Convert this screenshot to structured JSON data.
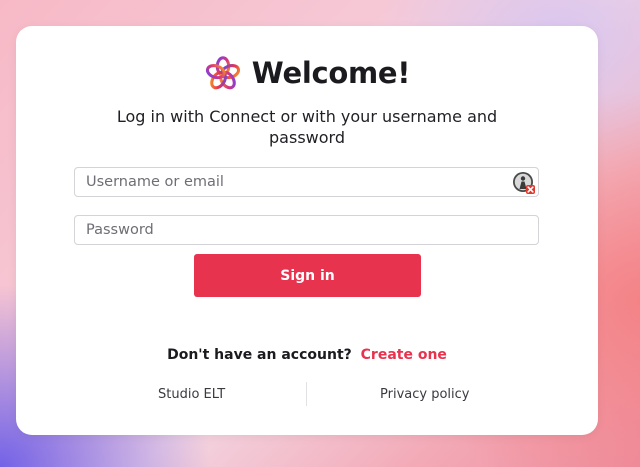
{
  "header": {
    "title": "Welcome!",
    "subtitle": "Log in with Connect or with your username and password",
    "logo_icon": "flower-ring-logo-icon"
  },
  "form": {
    "username_placeholder": "Username or email",
    "password_placeholder": "Password",
    "password_manager_icon": "password-manager-icon",
    "signin_label": "Sign in"
  },
  "signup": {
    "prompt": "Don't have an account?",
    "link_label": "Create one"
  },
  "footer": {
    "left_link": "Studio ELT",
    "right_link": "Privacy policy"
  },
  "colors": {
    "accent": "#e8334f",
    "text": "#1b1b1f",
    "border": "#d3d3d8"
  }
}
